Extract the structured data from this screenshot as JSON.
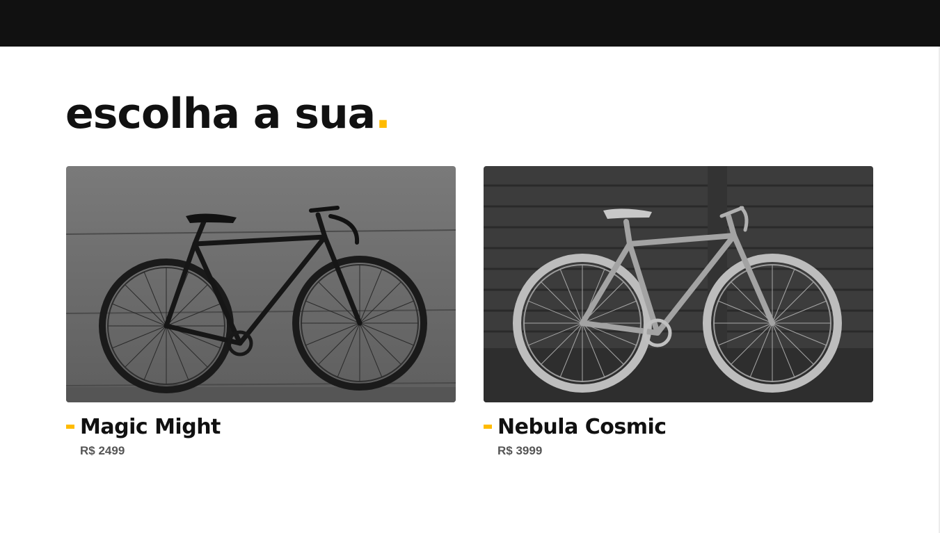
{
  "header": {
    "background": "#111111"
  },
  "section": {
    "title": "escolha a sua",
    "title_dot": ".",
    "accent_color": "#ffbb00"
  },
  "products": [
    {
      "name": "Magic Might",
      "price": "R$ 2499",
      "image": "black-fixed-gear-bicycle-photo",
      "frame_color": "dark"
    },
    {
      "name": "Nebula Cosmic",
      "price": "R$ 3999",
      "image": "light-grey-fixed-gear-bicycle-photo",
      "frame_color": "light"
    }
  ]
}
